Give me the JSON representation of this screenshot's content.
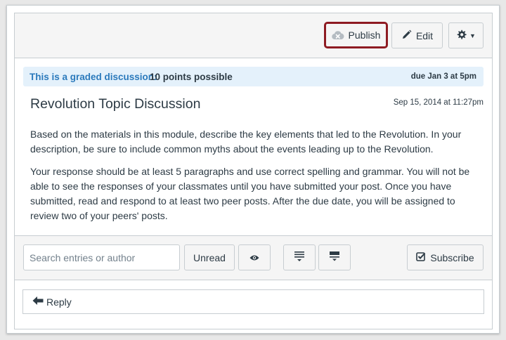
{
  "toolbar": {
    "publish_label": "Publish",
    "edit_label": "Edit",
    "settings_icon": "gear-icon",
    "colors": {
      "publish_highlight": "#8e1b22"
    }
  },
  "graded": {
    "label": "This is a graded discussion:",
    "points": "10 points possible",
    "due": "due Jan 3 at 5pm"
  },
  "topic": {
    "title": "Revolution Topic Discussion",
    "posted": "Sep 15, 2014 at 11:27pm",
    "paragraphs": [
      "Based on the materials in this module, describe the key elements that led to the Revolution. In your description, be sure to include common myths about the events leading up to the Revolution.",
      "Your response should be at least 5 paragraphs and use correct spelling and grammar. You will not be able to see the responses of your classmates until you have submitted your post. Once you have submitted, read and respond to at least two peer posts. After the due date, you will be assigned to review two of your peers' posts."
    ]
  },
  "controls": {
    "search_placeholder": "Search entries or author",
    "unread_label": "Unread",
    "subscribe_label": "Subscribe"
  },
  "reply": {
    "label": "Reply"
  }
}
